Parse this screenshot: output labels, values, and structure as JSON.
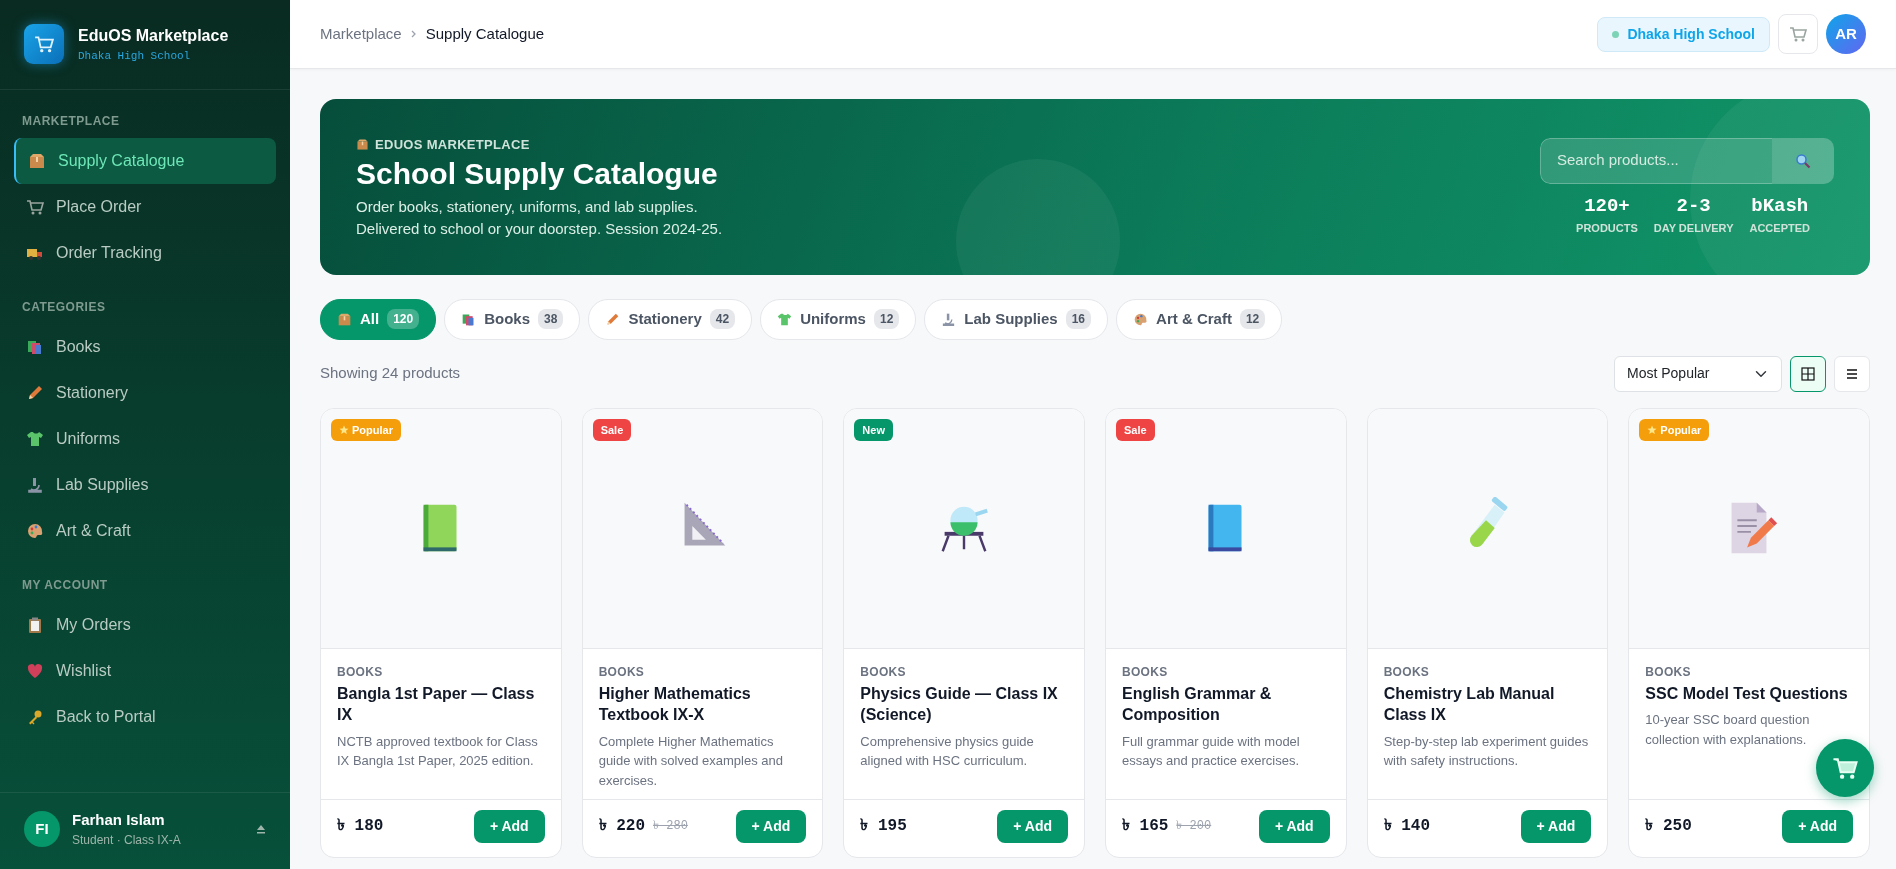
{
  "brand": {
    "title": "EduOS Marketplace",
    "subtitle": "Dhaka High School"
  },
  "sidebar": {
    "sections": [
      {
        "heading": "MARKETPLACE",
        "items": [
          {
            "label": "Supply Catalogue",
            "selected": true
          },
          {
            "label": "Place Order",
            "selected": false
          },
          {
            "label": "Order Tracking",
            "selected": false
          }
        ]
      },
      {
        "heading": "CATEGORIES",
        "items": [
          {
            "label": "Books",
            "selected": false
          },
          {
            "label": "Stationery",
            "selected": false
          },
          {
            "label": "Uniforms",
            "selected": false
          },
          {
            "label": "Lab Supplies",
            "selected": false
          },
          {
            "label": "Art & Craft",
            "selected": false
          }
        ]
      },
      {
        "heading": "MY ACCOUNT",
        "items": [
          {
            "label": "My Orders",
            "selected": false
          },
          {
            "label": "Wishlist",
            "selected": false
          },
          {
            "label": "Back to Portal",
            "selected": false
          }
        ]
      }
    ]
  },
  "user": {
    "initials": "FI",
    "name": "Farhan Islam",
    "role": "Student · Class IX-A"
  },
  "breadcrumb": [
    {
      "label": "Marketplace"
    },
    {
      "label": "Supply Catalogue"
    }
  ],
  "header": {
    "school": "Dhaka High School",
    "avatar": "AR"
  },
  "hero": {
    "eyebrow": "EDUOS MARKETPLACE",
    "title": "School Supply Catalogue",
    "description": "Order books, stationery, uniforms, and lab supplies.\nDelivered to school or your doorstep. Session 2024-25.",
    "search": {
      "placeholder": "Search products..."
    },
    "stats": [
      {
        "value": "120+",
        "label": "PRODUCTS"
      },
      {
        "value": "2-3",
        "label": "DAY DELIVERY"
      },
      {
        "value": "bKash",
        "label": "ACCEPTED"
      }
    ]
  },
  "filters": [
    {
      "label": "All",
      "count": "120",
      "selected": true
    },
    {
      "label": "Books",
      "count": "38",
      "selected": false
    },
    {
      "label": "Stationery",
      "count": "42",
      "selected": false
    },
    {
      "label": "Uniforms",
      "count": "12",
      "selected": false
    },
    {
      "label": "Lab Supplies",
      "count": "16",
      "selected": false
    },
    {
      "label": "Art & Craft",
      "count": "12",
      "selected": false
    }
  ],
  "result_count": "Showing 24 products",
  "sort": {
    "value": "Most Popular"
  },
  "view_toggle": [
    {
      "kind": "grid",
      "selected": true
    },
    {
      "kind": "list",
      "selected": false
    }
  ],
  "products": [
    {
      "badge": {
        "kind": "popular",
        "label": "Popular"
      },
      "category": "BOOKS",
      "name": "Bangla 1st Paper — Class IX",
      "description": "NCTB approved textbook for Class IX Bangla 1st Paper, 2025 edition.",
      "price": "৳ 180",
      "button": "+ Add"
    },
    {
      "badge": {
        "kind": "sale",
        "label": "Sale"
      },
      "category": "BOOKS",
      "name": "Higher Mathematics Textbook IX-X",
      "description": "Complete Higher Mathematics guide with solved examples and exercises.",
      "price": "৳ 220",
      "old_price": "৳ 280",
      "button": "+ Add"
    },
    {
      "badge": {
        "kind": "new",
        "label": "New"
      },
      "category": "BOOKS",
      "name": "Physics Guide — Class IX (Science)",
      "description": "Comprehensive physics guide aligned with HSC curriculum.",
      "price": "৳ 195",
      "button": "+ Add"
    },
    {
      "badge": {
        "kind": "sale",
        "label": "Sale"
      },
      "category": "BOOKS",
      "name": "English Grammar & Composition",
      "description": "Full grammar guide with model essays and practice exercises.",
      "price": "৳ 165",
      "old_price": "৳ 200",
      "button": "+ Add"
    },
    {
      "category": "BOOKS",
      "name": "Chemistry Lab Manual Class IX",
      "description": "Step-by-step lab experiment guides with safety instructions.",
      "price": "৳ 140",
      "button": "+ Add"
    },
    {
      "badge": {
        "kind": "popular",
        "label": "Popular"
      },
      "category": "BOOKS",
      "name": "SSC Model Test Questions",
      "description": "10-year SSC board question collection with explanations.",
      "price": "৳ 250",
      "button": "+ Add"
    }
  ]
}
